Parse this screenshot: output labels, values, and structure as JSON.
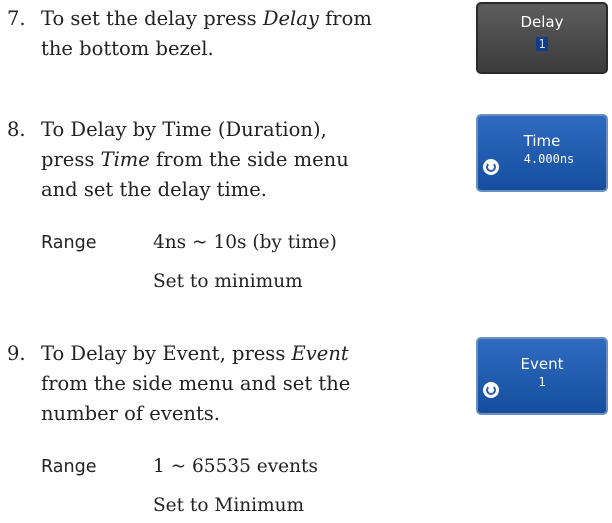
{
  "steps": [
    {
      "number": "7.",
      "parts": [
        "To set the delay press ",
        "Delay",
        " from the bottom bezel."
      ]
    },
    {
      "number": "8.",
      "parts": [
        "To Delay by Time (Duration), press ",
        "Time",
        " from the side menu and set the delay time."
      ],
      "range_label": "Range",
      "range_value": "4ns ~ 10s (by time)",
      "set_to": "Set to minimum"
    },
    {
      "number": "9.",
      "parts": [
        "To Delay by Event, press ",
        "Event",
        " from the side menu and set the number of events."
      ],
      "range_label": "Range",
      "range_value": "1 ~ 65535  events",
      "set_to": "Set to Minimum"
    }
  ],
  "buttons": {
    "delay": {
      "title": "Delay",
      "value": "1"
    },
    "time": {
      "title": "Time",
      "value": "4.000ns",
      "icon": "rotary-knob-icon"
    },
    "event": {
      "title": "Event",
      "value": "1",
      "icon": "rotary-knob-icon"
    }
  }
}
